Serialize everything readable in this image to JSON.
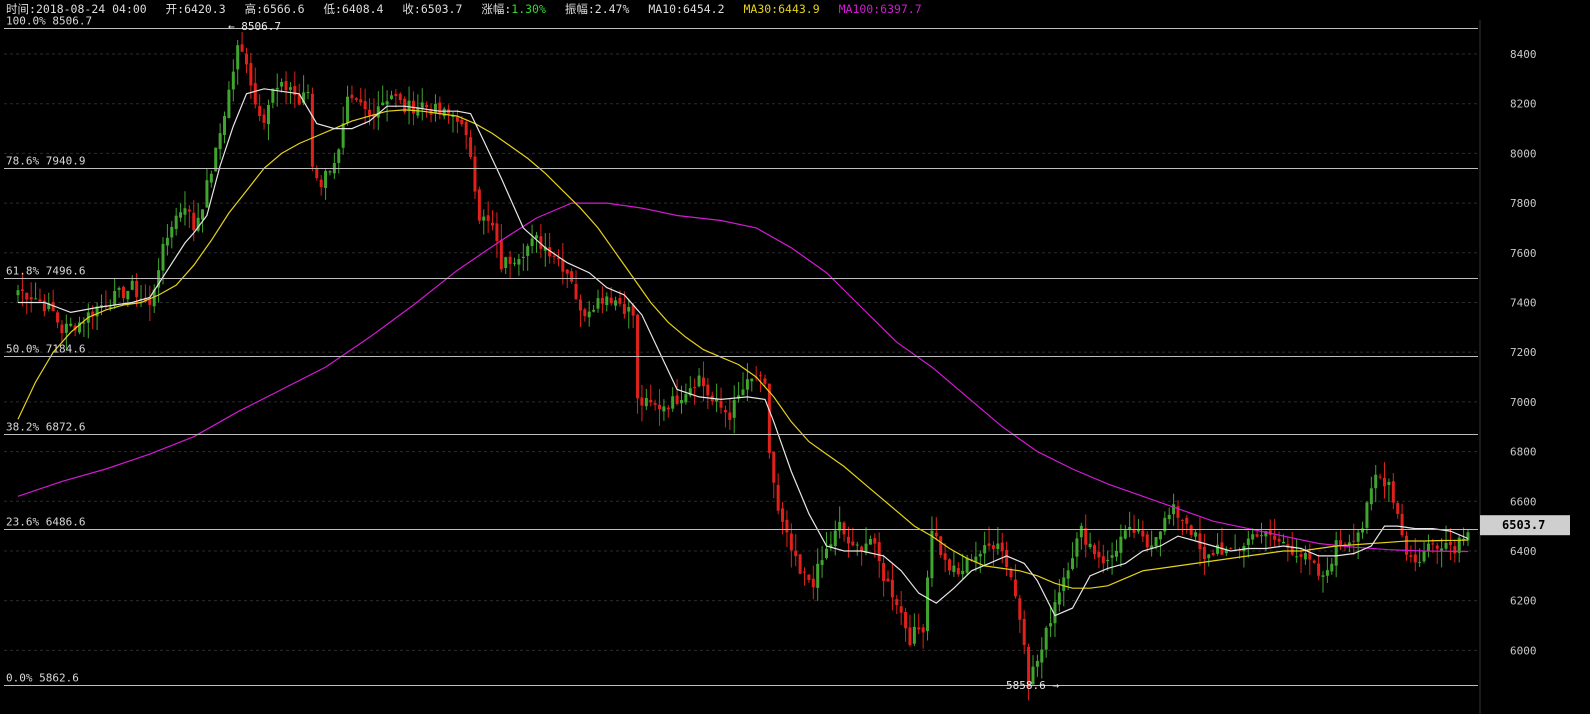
{
  "header": {
    "time_label": "时间",
    "time": "2018-08-24 04:00",
    "open_label": "开",
    "open": "6420.3",
    "high_label": "高",
    "high": "6566.6",
    "low_label": "低",
    "low": "6408.4",
    "close_label": "收",
    "close": "6503.7",
    "change_label": "涨幅",
    "change": "1.30%",
    "amplitude_label": "振幅",
    "amplitude": "2.47%",
    "ma10_label": "MA10",
    "ma10": "6454.2",
    "ma30_label": "MA30",
    "ma30": "6443.9",
    "ma100_label": "MA100",
    "ma100": "6397.7"
  },
  "colors": {
    "up": "#3fa52f",
    "down": "#e0211b",
    "ma10": "#e6e6e6",
    "ma30": "#e6d21a",
    "ma100": "#d21ad2",
    "change_up": "#2fdc2f",
    "fib_line": "#bdbdbd",
    "grid": "#2c2c2c",
    "price_tag_bg": "#cfcfcf"
  },
  "chart_data": {
    "type": "candlestick",
    "ylim": [
      5835,
      8530
    ],
    "y_ticks": [
      6000,
      6200,
      6400,
      6600,
      6800,
      7000,
      7200,
      7400,
      7600,
      7800,
      8000,
      8200,
      8400
    ],
    "last_price": "6503.7",
    "high_marker": "8506.7",
    "low_marker": "5858.6",
    "fib_levels": [
      {
        "label": "100.0% 8506.7",
        "price": 8506.7
      },
      {
        "label": "78.6% 7940.9",
        "price": 7940.9
      },
      {
        "label": "61.8% 7496.6",
        "price": 7496.6
      },
      {
        "label": "50.0% 7184.6",
        "price": 7184.6
      },
      {
        "label": "38.2% 6872.6",
        "price": 6872.6
      },
      {
        "label": "23.6% 6486.6",
        "price": 6486.6
      },
      {
        "label": "0.0% 5862.6",
        "price": 5862.6
      }
    ],
    "anchors": [
      [
        0,
        7450
      ],
      [
        4,
        7420
      ],
      [
        8,
        7360
      ],
      [
        10,
        7290
      ],
      [
        14,
        7320
      ],
      [
        18,
        7380
      ],
      [
        22,
        7420
      ],
      [
        26,
        7460
      ],
      [
        30,
        7380
      ],
      [
        32,
        7550
      ],
      [
        35,
        7720
      ],
      [
        38,
        7800
      ],
      [
        40,
        7700
      ],
      [
        42,
        7800
      ],
      [
        45,
        8000
      ],
      [
        48,
        8250
      ],
      [
        50,
        8420
      ],
      [
        52,
        8380
      ],
      [
        54,
        8200
      ],
      [
        56,
        8150
      ],
      [
        58,
        8250
      ],
      [
        62,
        8270
      ],
      [
        64,
        8200
      ],
      [
        66,
        8250
      ],
      [
        67,
        7950
      ],
      [
        69,
        7880
      ],
      [
        71,
        7950
      ],
      [
        73,
        8000
      ],
      [
        75,
        8200
      ],
      [
        78,
        8190
      ],
      [
        80,
        8150
      ],
      [
        82,
        8200
      ],
      [
        85,
        8240
      ],
      [
        88,
        8180
      ],
      [
        92,
        8200
      ],
      [
        96,
        8160
      ],
      [
        100,
        8150
      ],
      [
        103,
        8000
      ],
      [
        105,
        7750
      ],
      [
        108,
        7700
      ],
      [
        110,
        7550
      ],
      [
        114,
        7600
      ],
      [
        118,
        7650
      ],
      [
        122,
        7600
      ],
      [
        126,
        7500
      ],
      [
        128,
        7350
      ],
      [
        131,
        7400
      ],
      [
        134,
        7430
      ],
      [
        137,
        7400
      ],
      [
        140,
        7350
      ],
      [
        141,
        7000
      ],
      [
        145,
        6980
      ],
      [
        149,
        7000
      ],
      [
        152,
        7050
      ],
      [
        155,
        7100
      ],
      [
        158,
        7000
      ],
      [
        162,
        6950
      ],
      [
        165,
        7050
      ],
      [
        168,
        7100
      ],
      [
        170,
        7050
      ],
      [
        171,
        6800
      ],
      [
        173,
        6550
      ],
      [
        175,
        6450
      ],
      [
        178,
        6300
      ],
      [
        181,
        6280
      ],
      [
        184,
        6400
      ],
      [
        187,
        6500
      ],
      [
        190,
        6400
      ],
      [
        194,
        6450
      ],
      [
        197,
        6300
      ],
      [
        200,
        6200
      ],
      [
        203,
        6050
      ],
      [
        206,
        6100
      ],
      [
        208,
        6500
      ],
      [
        211,
        6350
      ],
      [
        214,
        6300
      ],
      [
        217,
        6380
      ],
      [
        220,
        6400
      ],
      [
        223,
        6450
      ],
      [
        226,
        6300
      ],
      [
        229,
        6050
      ],
      [
        230,
        5880
      ],
      [
        233,
        6000
      ],
      [
        236,
        6200
      ],
      [
        239,
        6350
      ],
      [
        242,
        6480
      ],
      [
        245,
        6400
      ],
      [
        248,
        6350
      ],
      [
        251,
        6450
      ],
      [
        254,
        6480
      ],
      [
        257,
        6420
      ],
      [
        260,
        6500
      ],
      [
        263,
        6560
      ],
      [
        266,
        6520
      ],
      [
        268,
        6450
      ],
      [
        270,
        6350
      ],
      [
        273,
        6420
      ],
      [
        276,
        6380
      ],
      [
        279,
        6430
      ],
      [
        282,
        6480
      ],
      [
        285,
        6450
      ],
      [
        288,
        6430
      ],
      [
        291,
        6400
      ],
      [
        294,
        6350
      ],
      [
        297,
        6280
      ],
      [
        300,
        6420
      ],
      [
        303,
        6450
      ],
      [
        306,
        6500
      ],
      [
        309,
        6700
      ],
      [
        312,
        6680
      ],
      [
        314,
        6550
      ],
      [
        316,
        6400
      ],
      [
        318,
        6350
      ],
      [
        321,
        6420
      ],
      [
        324,
        6440
      ],
      [
        327,
        6420
      ],
      [
        330,
        6500
      ]
    ],
    "ma10_points": [
      [
        0,
        7400
      ],
      [
        6,
        7400
      ],
      [
        12,
        7360
      ],
      [
        18,
        7380
      ],
      [
        22,
        7390
      ],
      [
        26,
        7400
      ],
      [
        30,
        7420
      ],
      [
        34,
        7530
      ],
      [
        38,
        7640
      ],
      [
        40,
        7680
      ],
      [
        43,
        7750
      ],
      [
        46,
        7950
      ],
      [
        49,
        8110
      ],
      [
        52,
        8240
      ],
      [
        56,
        8260
      ],
      [
        60,
        8250
      ],
      [
        64,
        8240
      ],
      [
        68,
        8120
      ],
      [
        72,
        8100
      ],
      [
        76,
        8100
      ],
      [
        80,
        8130
      ],
      [
        84,
        8190
      ],
      [
        88,
        8190
      ],
      [
        92,
        8180
      ],
      [
        96,
        8170
      ],
      [
        100,
        8170
      ],
      [
        103,
        8160
      ],
      [
        106,
        8050
      ],
      [
        110,
        7900
      ],
      [
        115,
        7700
      ],
      [
        120,
        7620
      ],
      [
        125,
        7560
      ],
      [
        130,
        7520
      ],
      [
        134,
        7460
      ],
      [
        138,
        7430
      ],
      [
        142,
        7350
      ],
      [
        146,
        7200
      ],
      [
        150,
        7050
      ],
      [
        155,
        7020
      ],
      [
        160,
        7010
      ],
      [
        166,
        7020
      ],
      [
        170,
        7010
      ],
      [
        172,
        6920
      ],
      [
        176,
        6720
      ],
      [
        180,
        6550
      ],
      [
        184,
        6420
      ],
      [
        188,
        6400
      ],
      [
        192,
        6400
      ],
      [
        197,
        6380
      ],
      [
        201,
        6320
      ],
      [
        205,
        6230
      ],
      [
        209,
        6190
      ],
      [
        213,
        6250
      ],
      [
        217,
        6320
      ],
      [
        221,
        6350
      ],
      [
        225,
        6380
      ],
      [
        229,
        6350
      ],
      [
        232,
        6280
      ],
      [
        236,
        6140
      ],
      [
        240,
        6170
      ],
      [
        244,
        6300
      ],
      [
        248,
        6330
      ],
      [
        252,
        6350
      ],
      [
        256,
        6400
      ],
      [
        260,
        6420
      ],
      [
        264,
        6460
      ],
      [
        268,
        6440
      ],
      [
        272,
        6420
      ],
      [
        276,
        6400
      ],
      [
        280,
        6410
      ],
      [
        284,
        6410
      ],
      [
        288,
        6420
      ],
      [
        292,
        6410
      ],
      [
        296,
        6380
      ],
      [
        300,
        6380
      ],
      [
        304,
        6390
      ],
      [
        308,
        6420
      ],
      [
        311,
        6500
      ],
      [
        314,
        6500
      ],
      [
        318,
        6490
      ],
      [
        322,
        6490
      ],
      [
        326,
        6480
      ],
      [
        330,
        6450
      ]
    ],
    "ma30_points": [
      [
        0,
        6930
      ],
      [
        4,
        7080
      ],
      [
        8,
        7200
      ],
      [
        12,
        7280
      ],
      [
        16,
        7340
      ],
      [
        20,
        7370
      ],
      [
        24,
        7390
      ],
      [
        28,
        7400
      ],
      [
        32,
        7430
      ],
      [
        36,
        7470
      ],
      [
        40,
        7550
      ],
      [
        44,
        7650
      ],
      [
        48,
        7760
      ],
      [
        52,
        7850
      ],
      [
        56,
        7940
      ],
      [
        60,
        8000
      ],
      [
        64,
        8040
      ],
      [
        68,
        8070
      ],
      [
        72,
        8100
      ],
      [
        76,
        8130
      ],
      [
        80,
        8150
      ],
      [
        84,
        8170
      ],
      [
        88,
        8175
      ],
      [
        92,
        8170
      ],
      [
        96,
        8160
      ],
      [
        100,
        8150
      ],
      [
        104,
        8120
      ],
      [
        108,
        8080
      ],
      [
        112,
        8030
      ],
      [
        116,
        7980
      ],
      [
        120,
        7920
      ],
      [
        124,
        7850
      ],
      [
        128,
        7780
      ],
      [
        132,
        7700
      ],
      [
        136,
        7600
      ],
      [
        140,
        7500
      ],
      [
        144,
        7400
      ],
      [
        148,
        7320
      ],
      [
        152,
        7260
      ],
      [
        156,
        7210
      ],
      [
        160,
        7180
      ],
      [
        164,
        7150
      ],
      [
        168,
        7100
      ],
      [
        172,
        7020
      ],
      [
        176,
        6920
      ],
      [
        180,
        6840
      ],
      [
        184,
        6790
      ],
      [
        188,
        6740
      ],
      [
        192,
        6680
      ],
      [
        196,
        6620
      ],
      [
        200,
        6560
      ],
      [
        204,
        6500
      ],
      [
        208,
        6460
      ],
      [
        212,
        6410
      ],
      [
        216,
        6370
      ],
      [
        220,
        6340
      ],
      [
        224,
        6330
      ],
      [
        228,
        6320
      ],
      [
        232,
        6300
      ],
      [
        236,
        6270
      ],
      [
        240,
        6250
      ],
      [
        244,
        6250
      ],
      [
        248,
        6260
      ],
      [
        252,
        6290
      ],
      [
        256,
        6320
      ],
      [
        260,
        6330
      ],
      [
        264,
        6340
      ],
      [
        268,
        6350
      ],
      [
        272,
        6360
      ],
      [
        276,
        6370
      ],
      [
        280,
        6380
      ],
      [
        284,
        6390
      ],
      [
        288,
        6400
      ],
      [
        292,
        6400
      ],
      [
        296,
        6410
      ],
      [
        300,
        6420
      ],
      [
        304,
        6425
      ],
      [
        308,
        6430
      ],
      [
        312,
        6435
      ],
      [
        316,
        6440
      ],
      [
        320,
        6440
      ],
      [
        324,
        6442
      ],
      [
        328,
        6443
      ],
      [
        330,
        6444
      ]
    ],
    "ma100_points": [
      [
        0,
        6620
      ],
      [
        10,
        6680
      ],
      [
        20,
        6730
      ],
      [
        30,
        6790
      ],
      [
        40,
        6860
      ],
      [
        50,
        6960
      ],
      [
        60,
        7050
      ],
      [
        70,
        7140
      ],
      [
        80,
        7260
      ],
      [
        90,
        7390
      ],
      [
        100,
        7530
      ],
      [
        110,
        7650
      ],
      [
        118,
        7740
      ],
      [
        126,
        7800
      ],
      [
        134,
        7800
      ],
      [
        142,
        7780
      ],
      [
        150,
        7750
      ],
      [
        160,
        7730
      ],
      [
        168,
        7700
      ],
      [
        176,
        7620
      ],
      [
        184,
        7520
      ],
      [
        192,
        7380
      ],
      [
        200,
        7240
      ],
      [
        208,
        7140
      ],
      [
        216,
        7020
      ],
      [
        224,
        6900
      ],
      [
        232,
        6800
      ],
      [
        240,
        6730
      ],
      [
        248,
        6670
      ],
      [
        256,
        6620
      ],
      [
        264,
        6570
      ],
      [
        272,
        6520
      ],
      [
        280,
        6490
      ],
      [
        288,
        6460
      ],
      [
        296,
        6430
      ],
      [
        304,
        6415
      ],
      [
        312,
        6405
      ],
      [
        320,
        6400
      ],
      [
        330,
        6398
      ]
    ]
  }
}
